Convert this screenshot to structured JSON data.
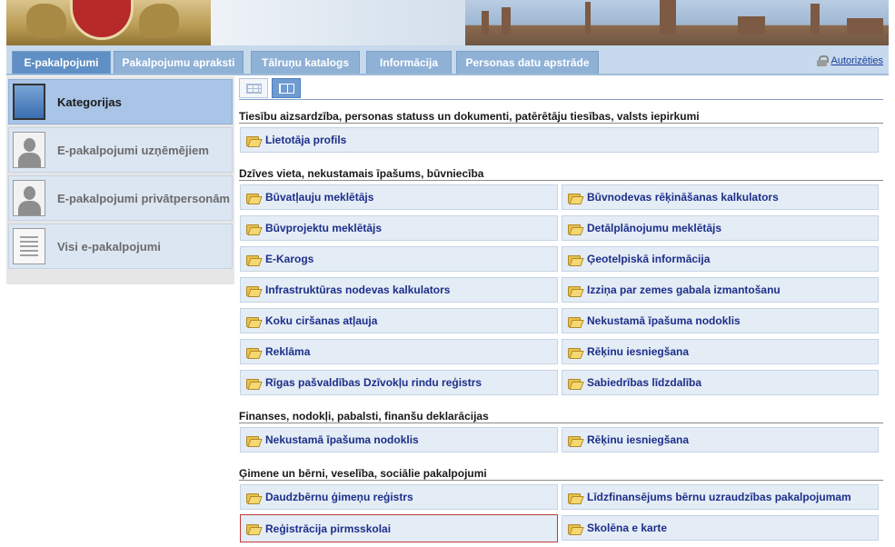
{
  "nav": {
    "tabs": [
      {
        "label": "E-pakalpojumi"
      },
      {
        "label": "Pakalpojumu apraksti"
      },
      {
        "label": "Tālruņu katalogs"
      },
      {
        "label": "Informācija"
      },
      {
        "label": "Personas datu apstrāde"
      }
    ],
    "auth_link": "Autorizēties"
  },
  "sidebar": {
    "items": [
      {
        "label": "Kategorijas",
        "icon": "folder-icon"
      },
      {
        "label": "E-pakalpojumi uzņēmējiem",
        "icon": "person-icon"
      },
      {
        "label": "E-pakalpojumi privātpersonām",
        "icon": "person-icon"
      },
      {
        "label": "Visi e-pakalpojumi",
        "icon": "document-icon"
      }
    ]
  },
  "sections": [
    {
      "title": "Tiesību aizsardzība, personas statuss un dokumenti, patērētāju tiesības, valsts iepirkumi",
      "items": [
        "Lietotāja profils"
      ]
    },
    {
      "title": "Dzīves vieta, nekustamais īpašums, būvniecība",
      "items": [
        "Būvatļauju meklētājs",
        "Būvnodevas rēķināšanas kalkulators",
        "Būvprojektu meklētājs",
        "Detālplānojumu meklētājs",
        "E-Karogs",
        "Ģeotelpiskā informācija",
        "Infrastruktūras nodevas kalkulators",
        "Izziņa par zemes gabala izmantošanu",
        "Koku ciršanas atļauja",
        "Nekustamā īpašuma nodoklis",
        "Reklāma",
        "Rēķinu iesniegšana",
        "Rīgas pašvaldības Dzīvokļu rindu reģistrs",
        "Sabiedrības līdzdalība"
      ]
    },
    {
      "title": "Finanses, nodokļi, pabalsti, finanšu deklarācijas",
      "items": [
        "Nekustamā īpašuma nodoklis",
        "Rēķinu iesniegšana"
      ]
    },
    {
      "title": "Ģimene un bērni, veselība, sociālie pakalpojumi",
      "items": [
        "Daudzbērnu ģimeņu reģistrs",
        "Līdzfinansējums bērnu uzraudzības pakalpojumam",
        "Reģistrācija pirmsskolai",
        "Skolēna e karte"
      ]
    }
  ],
  "colors": {
    "nav_bg": "#c7d9ec",
    "tab_bg": "#8fb1d6",
    "tab_active": "#5f8fc4",
    "item_bg": "#e4ecf5",
    "item_text": "#1d2f8a",
    "highlight_border": "#c03a3a"
  }
}
